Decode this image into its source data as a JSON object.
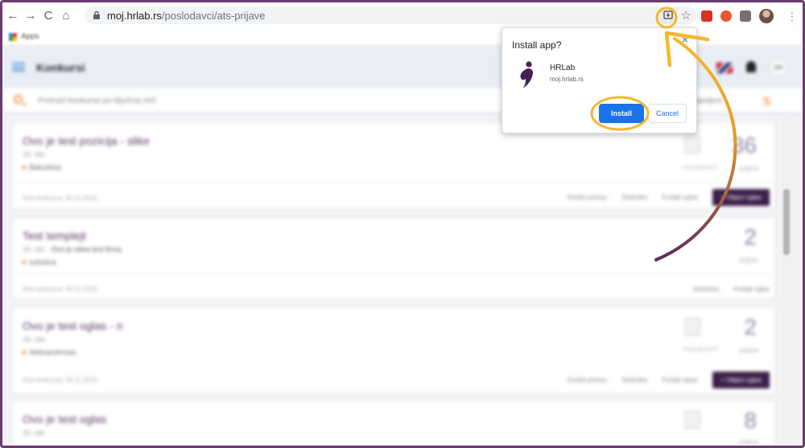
{
  "browser": {
    "url_domain": "moj.hrlab.rs",
    "url_path": "/poslodavci/ats-prijave",
    "back_glyph": "←",
    "forward_glyph": "→",
    "reload_glyph": "C",
    "home_glyph": "⌂",
    "star_glyph": "☆",
    "menu_glyph": "⋮"
  },
  "bookmarks": {
    "apps_label": "Apps"
  },
  "app": {
    "title": "Konkursi",
    "search_placeholder": "Pretraži konkurse po ključnoj reči",
    "filter_right_text": "objavljeni",
    "more_glyph": "•••",
    "sort_glyph": "⇅"
  },
  "jobs": [
    {
      "title": "Ovo je test pozicija - slike",
      "sub": "16. okt",
      "company": "",
      "location": "Bakudrica",
      "footer": "Rok konkursa: 30.11.2020.",
      "count": "36",
      "count_label": "prijava",
      "icon_label": "nepregledanih",
      "actions": [
        "Dodeli pristup",
        "Statistika",
        "Pošalji oglas"
      ],
      "primary": "+ Objavi oglas"
    },
    {
      "title": "Test templejt",
      "sub": "20. okt.",
      "company": "Ovo je neka test firma",
      "location": "subotica",
      "footer": "Rok konkursa: 08.12.2020.",
      "count": "2",
      "count_label": "prijave",
      "icon_label": "",
      "actions": [
        "Statistika",
        "Pošalji oglas"
      ],
      "primary": ""
    },
    {
      "title": "Ovo je test oglas - n",
      "sub": "20. okt.",
      "company": "",
      "location": "Aleksandrovac",
      "footer": "Rok konkursa: 09.11.2020.",
      "count": "2",
      "count_label": "prijave",
      "icon_label": "nepregledanih",
      "actions": [
        "Dodeli pristup",
        "Statistika",
        "Pošalji oglas"
      ],
      "primary": "+ Objavi oglas"
    },
    {
      "title": "Ovo je test oglas",
      "sub": "20. okt.",
      "company": "",
      "location": "",
      "footer": "",
      "count": "8",
      "count_label": "prijava",
      "icon_label": "",
      "actions": [],
      "primary": ""
    }
  ],
  "popup": {
    "title": "Install app?",
    "close_glyph": "×",
    "app_name": "HRLab",
    "app_domain": "moj.hrlab.rs",
    "install_label": "Install",
    "cancel_label": "Cancel"
  },
  "colors": {
    "brand_purple": "#3b1f4a",
    "accent_orange": "#f08a33",
    "install_blue": "#1a73e8",
    "highlight_yellow": "#f5b82e",
    "frame_purple": "#6b3a6e"
  }
}
